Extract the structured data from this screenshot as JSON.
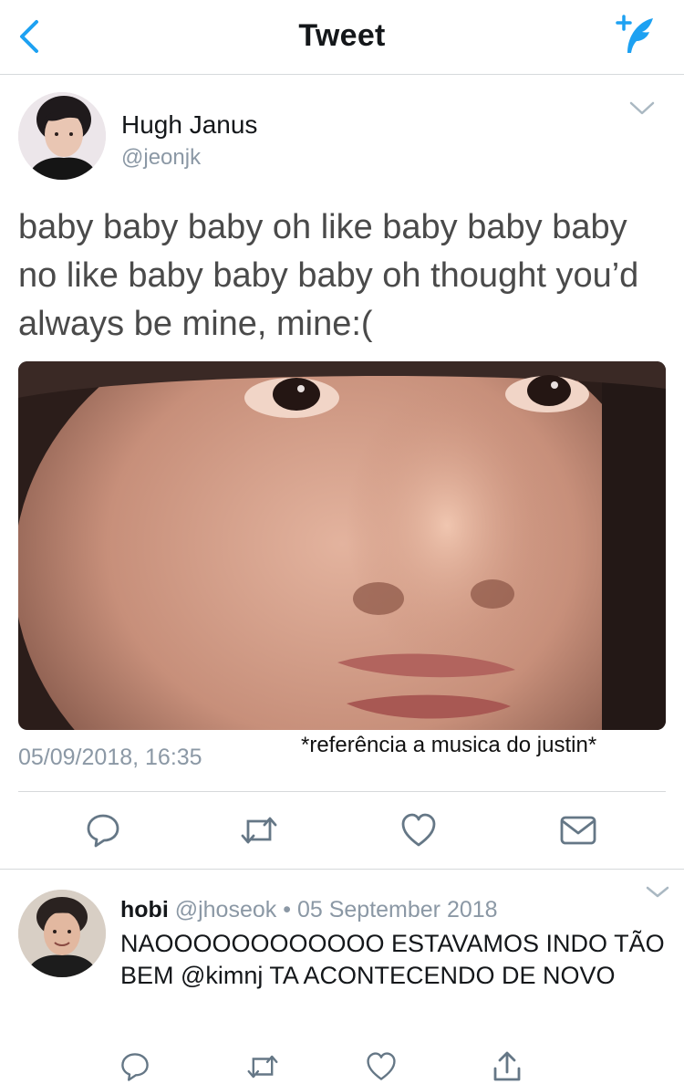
{
  "header": {
    "title": "Tweet",
    "back_icon": "chevron-left-icon",
    "compose_icon": "compose-tweet-icon",
    "accent_color": "#1da1f2"
  },
  "tweet": {
    "author_name": "Hugh Janus",
    "author_handle": "@jeonjk",
    "text": "baby baby baby oh like baby baby baby no like baby baby baby oh thought you’d always be mine, mine:(",
    "timestamp": "05/09/2018, 16:35",
    "overlay_caption": "*referência a musica do justin*",
    "actions": [
      "reply-icon",
      "retweet-icon",
      "like-icon",
      "direct-message-icon"
    ]
  },
  "reply": {
    "author_name": "hobi",
    "author_handle": "@jhoseok",
    "separator": "•",
    "date": "05 September 2018",
    "text": "NAOOOOOOOOOOOO ESTAVAMOS INDO TÃO BEM @kimnj TA ACONTECENDO DE NOVO",
    "actions": [
      "reply-icon",
      "retweet-icon",
      "like-icon",
      "share-icon"
    ]
  },
  "colors": {
    "secondary_text": "#8b98a5",
    "divider": "#d6d9db",
    "icon": "#657786"
  }
}
